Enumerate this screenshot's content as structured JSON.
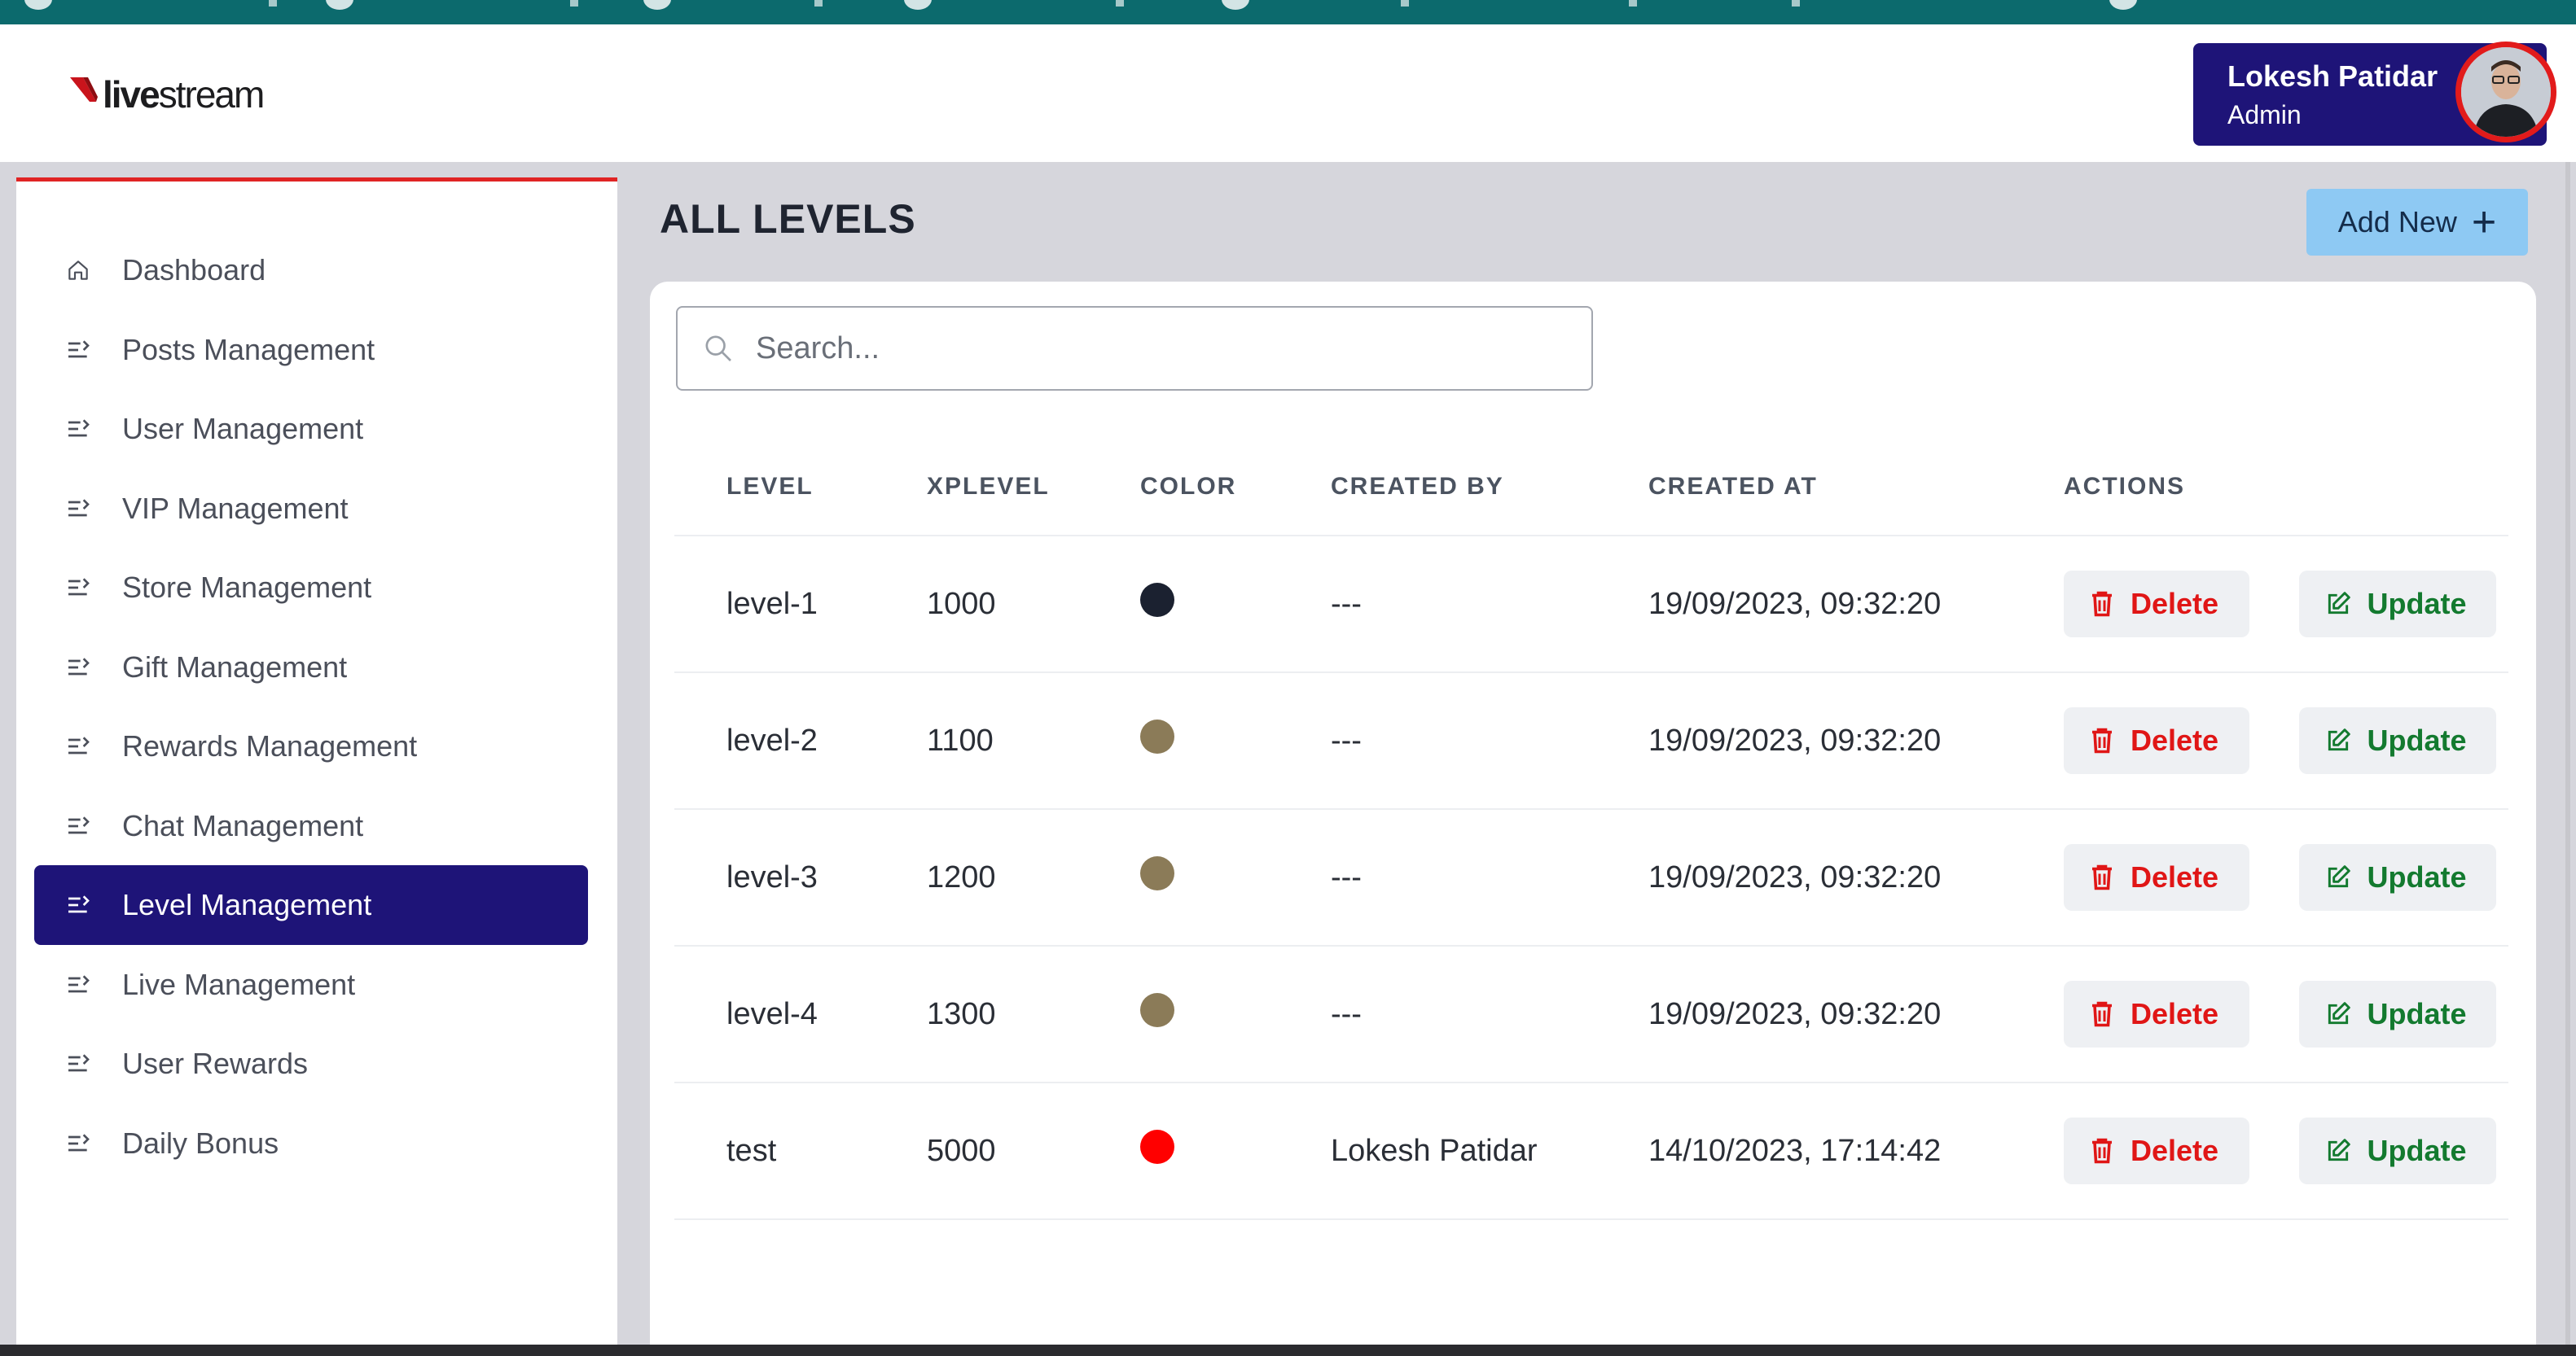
{
  "app": {
    "logo_text_bold": "live",
    "logo_text": "stream",
    "accent_color": "#1e1478",
    "brand_color": "#e02424"
  },
  "profile": {
    "name": "Lokesh Patidar",
    "role": "Admin"
  },
  "sidebar": {
    "items": [
      {
        "label": "Dashboard",
        "icon": "home-icon"
      },
      {
        "label": "Posts Management",
        "icon": "menu-arrow-icon"
      },
      {
        "label": "User Management",
        "icon": "menu-arrow-icon"
      },
      {
        "label": "VIP Management",
        "icon": "menu-arrow-icon"
      },
      {
        "label": "Store Management",
        "icon": "menu-arrow-icon"
      },
      {
        "label": "Gift Management",
        "icon": "menu-arrow-icon"
      },
      {
        "label": "Rewards Management",
        "icon": "menu-arrow-icon"
      },
      {
        "label": "Chat Management",
        "icon": "menu-arrow-icon"
      },
      {
        "label": "Level Management",
        "icon": "menu-arrow-icon",
        "active": true
      },
      {
        "label": "Live Management",
        "icon": "menu-arrow-icon"
      },
      {
        "label": "User Rewards",
        "icon": "menu-arrow-icon"
      },
      {
        "label": "Daily Bonus",
        "icon": "menu-arrow-icon"
      }
    ]
  },
  "main": {
    "title": "ALL LEVELS",
    "add_new_label": "Add New",
    "search_placeholder": "Search...",
    "table": {
      "headers": [
        "LEVEL",
        "XPLEVEL",
        "COLOR",
        "CREATED BY",
        "CREATED AT",
        "ACTIONS"
      ],
      "rows": [
        {
          "level": "level-1",
          "xplevel": "1000",
          "color": "#1b2130",
          "created_by": "---",
          "created_at": "19/09/2023, 09:32:20"
        },
        {
          "level": "level-2",
          "xplevel": "1100",
          "color": "#8b7b58",
          "created_by": "---",
          "created_at": "19/09/2023, 09:32:20"
        },
        {
          "level": "level-3",
          "xplevel": "1200",
          "color": "#8b7b58",
          "created_by": "---",
          "created_at": "19/09/2023, 09:32:20"
        },
        {
          "level": "level-4",
          "xplevel": "1300",
          "color": "#8b7b58",
          "created_by": "---",
          "created_at": "19/09/2023, 09:32:20"
        },
        {
          "level": "test",
          "xplevel": "5000",
          "color": "#ff0000",
          "created_by": "Lokesh Patidar",
          "created_at": "14/10/2023, 17:14:42"
        }
      ],
      "delete_label": "Delete",
      "update_label": "Update"
    }
  }
}
